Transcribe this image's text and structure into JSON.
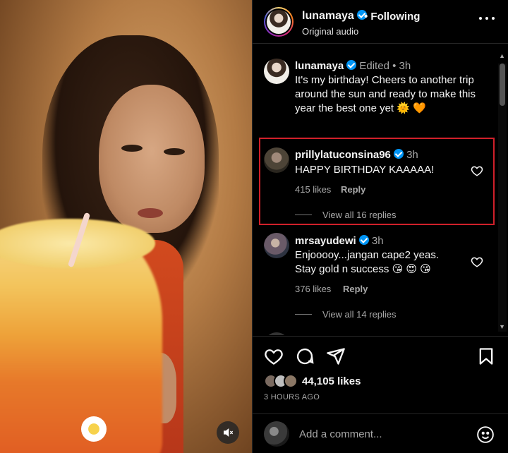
{
  "post": {
    "username": "lunamaya",
    "follow_status": "Following",
    "audio": "Original audio"
  },
  "caption": {
    "username": "lunamaya",
    "meta": "Edited • 3h",
    "text": "It's my birthday! Cheers to another trip around the sun and ready to make this year the best one yet 🌞 🧡"
  },
  "comments": [
    {
      "username": "prillylatuconsina96",
      "time": "3h",
      "text": "HAPPY BIRTHDAY KAAAAA!",
      "likes": "415 likes",
      "reply": "Reply",
      "view_replies": "View all 16 replies"
    },
    {
      "username": "mrsayudewi",
      "time": "3h",
      "text_line1": "Enjooooy...jangan cape2 yeas.",
      "text_line2": "Stay gold n success 😘 😍 😘",
      "likes": "376 likes",
      "reply": "Reply",
      "view_replies": "View all 14 replies"
    }
  ],
  "stats": {
    "likes": "44,105 likes",
    "time_ago": "3 HOURS AGO"
  },
  "composer": {
    "placeholder": "Add a comment..."
  },
  "icons": [
    "verified-icon",
    "more-icon",
    "heart-icon",
    "comment-icon",
    "share-icon",
    "bookmark-icon",
    "mute-icon",
    "emoji-icon"
  ],
  "colors": {
    "verified": "#0095f6",
    "highlight": "#d0202a"
  }
}
